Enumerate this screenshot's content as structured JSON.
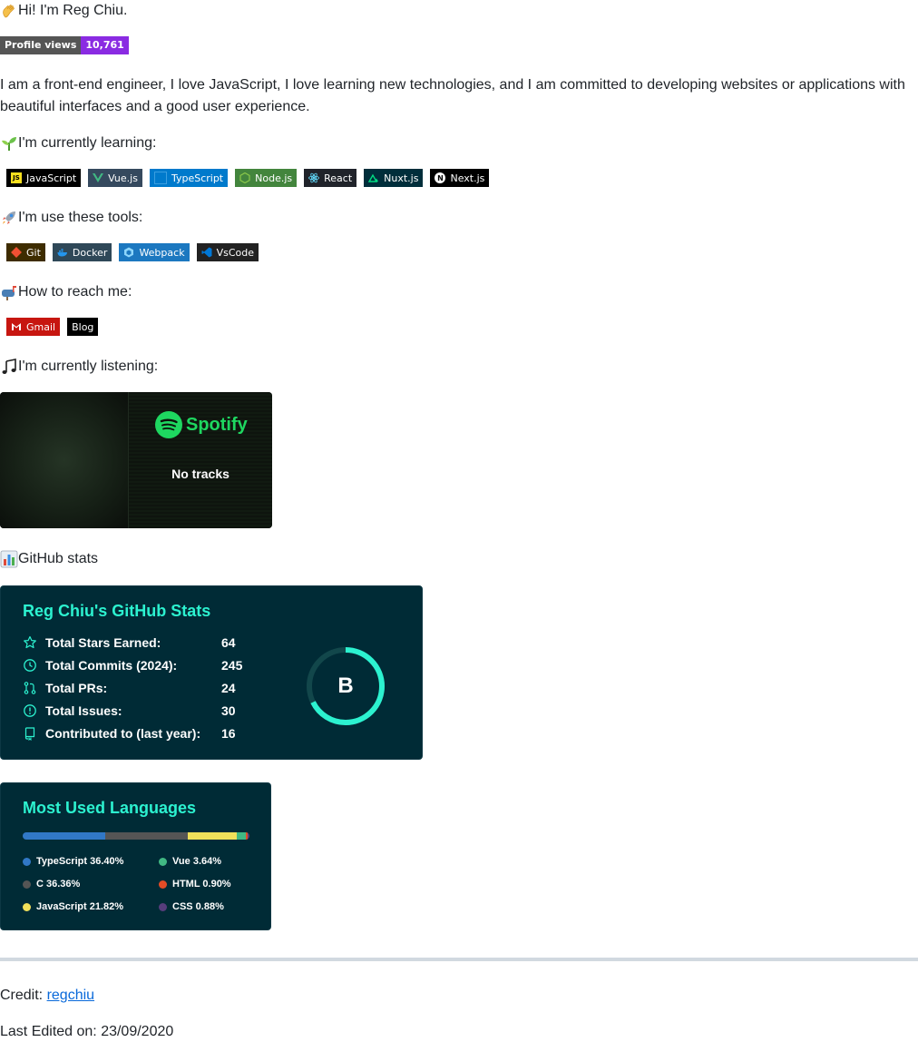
{
  "greeting": "Hi! I'm Reg Chiu.",
  "profile_views": {
    "label": "Profile views",
    "count": "10,761"
  },
  "intro": "I am a front-end engineer, I love JavaScript, I love learning new technologies, and I am committed to developing websites or applications with beautiful interfaces and a good user experience.",
  "learning": {
    "heading": "I'm currently learning:",
    "badges": [
      {
        "label": "JavaScript",
        "bg": "#000000",
        "icon": "javascript-icon"
      },
      {
        "label": "Vue.js",
        "bg": "#35495e",
        "icon": "vue-icon"
      },
      {
        "label": "TypeScript",
        "bg": "#007acc",
        "icon": "typescript-icon"
      },
      {
        "label": "Node.js",
        "bg": "#43853d",
        "icon": "node-icon"
      },
      {
        "label": "React",
        "bg": "#20232a",
        "icon": "react-icon"
      },
      {
        "label": "Nuxt.js",
        "bg": "#002e3b",
        "icon": "nuxt-icon"
      },
      {
        "label": "Next.js",
        "bg": "#000000",
        "icon": "next-icon"
      }
    ]
  },
  "tools": {
    "heading": "I'm use these tools:",
    "badges": [
      {
        "label": "Git",
        "bg": "#3e2c00",
        "icon": "git-icon"
      },
      {
        "label": "Docker",
        "bg": "#2f4858",
        "icon": "docker-icon"
      },
      {
        "label": "Webpack",
        "bg": "#1c78c0",
        "icon": "webpack-icon"
      },
      {
        "label": "VsCode",
        "bg": "#222222",
        "icon": "vscode-icon"
      }
    ]
  },
  "reach": {
    "heading": "How to reach me:",
    "badges": [
      {
        "label": "Gmail",
        "bg": "#c71610",
        "icon": "gmail-icon"
      },
      {
        "label": "Blog",
        "bg": "#000000",
        "icon": ""
      }
    ]
  },
  "listening": {
    "heading": "I'm currently listening:",
    "brand": "Spotify",
    "status": "No tracks"
  },
  "stats_heading": "GitHub stats",
  "github_stats": {
    "title": "Reg Chiu's GitHub Stats",
    "rows": [
      {
        "label": "Total Stars Earned:",
        "value": "64",
        "icon": "star-icon"
      },
      {
        "label": "Total Commits (2024):",
        "value": "245",
        "icon": "history-icon"
      },
      {
        "label": "Total PRs:",
        "value": "24",
        "icon": "pull-request-icon"
      },
      {
        "label": "Total Issues:",
        "value": "30",
        "icon": "issue-icon"
      },
      {
        "label": "Contributed to (last year):",
        "value": "16",
        "icon": "repo-icon"
      }
    ],
    "grade": "B",
    "accent": "#2cf2d0",
    "bg": "#002b36"
  },
  "languages": {
    "title": "Most Used Languages",
    "items": [
      {
        "name": "TypeScript",
        "percent": 36.4,
        "label": "TypeScript 36.40%",
        "color": "#3178c6"
      },
      {
        "name": "C",
        "percent": 36.36,
        "label": "C 36.36%",
        "color": "#555555"
      },
      {
        "name": "JavaScript",
        "percent": 21.82,
        "label": "JavaScript 21.82%",
        "color": "#f1e05a"
      },
      {
        "name": "Vue",
        "percent": 3.64,
        "label": "Vue 3.64%",
        "color": "#41b883"
      },
      {
        "name": "HTML",
        "percent": 0.9,
        "label": "HTML 0.90%",
        "color": "#e34c26"
      },
      {
        "name": "CSS",
        "percent": 0.88,
        "label": "CSS 0.88%",
        "color": "#563d7c"
      }
    ]
  },
  "footer": {
    "credit_label": "Credit:",
    "credit_link": "regchiu",
    "last_edited": "Last Edited on: 23/09/2020"
  }
}
